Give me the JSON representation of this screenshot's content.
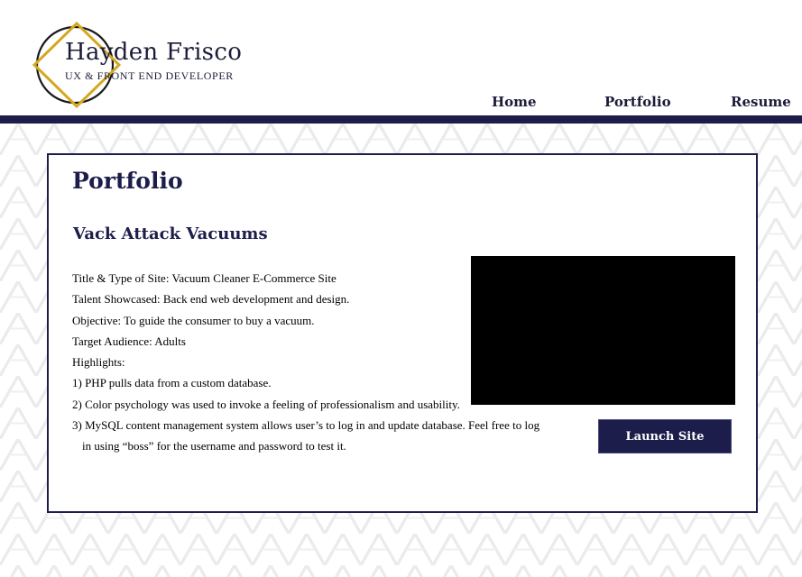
{
  "brand": {
    "name": "Hayden Frisco",
    "tagline": "UX & FRONT END DEVELOPER",
    "colors": {
      "navy": "#1c1d4b",
      "gold": "#d4a820"
    }
  },
  "nav": {
    "items": [
      {
        "label": "Home"
      },
      {
        "label": "Portfolio"
      },
      {
        "label": "Resume"
      }
    ]
  },
  "main": {
    "page_title": "Portfolio",
    "project": {
      "title": "Vack Attack Vacuums",
      "lines": [
        "Title & Type of Site: Vacuum Cleaner E-Commerce Site",
        "Talent Showcased: Back end web development and design.",
        "Objective:  To guide the consumer to buy a vacuum.",
        "Target Audience: Adults",
        "Highlights:",
        "1) PHP pulls data from a custom database.",
        "2) Color psychology was used to invoke a feeling of professionalism and usability.",
        "3) MySQL content management system allows user’s to log in and update database. Feel free to log",
        "in using “boss” for the username and password to test it."
      ],
      "launch_label": "Launch Site"
    }
  }
}
